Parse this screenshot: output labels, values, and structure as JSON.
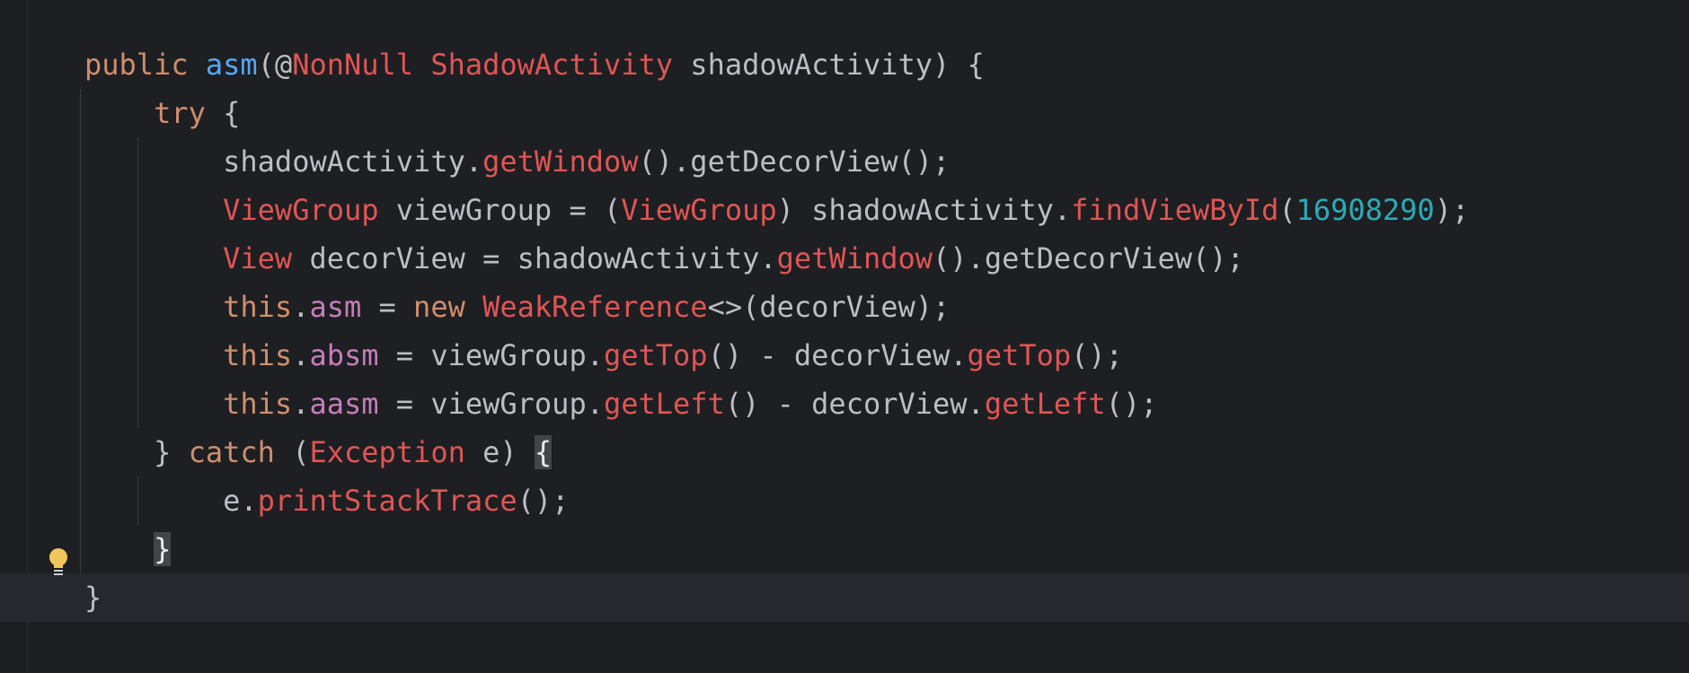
{
  "editor": {
    "lines": [
      [
        {
          "t": "public ",
          "c": "kw"
        },
        {
          "t": "asm",
          "c": "fn-decl"
        },
        {
          "t": "(@",
          "c": "plain"
        },
        {
          "t": "NonNull",
          "c": "type"
        },
        {
          "t": " ",
          "c": "plain"
        },
        {
          "t": "ShadowActivity",
          "c": "type"
        },
        {
          "t": " shadowActivity) {",
          "c": "plain"
        }
      ],
      [
        {
          "t": "    ",
          "c": "plain"
        },
        {
          "t": "try",
          "c": "kw"
        },
        {
          "t": " {",
          "c": "plain"
        }
      ],
      [
        {
          "t": "        shadowActivity.",
          "c": "plain"
        },
        {
          "t": "getWindow",
          "c": "method"
        },
        {
          "t": "().getDecorView();",
          "c": "plain"
        }
      ],
      [
        {
          "t": "        ",
          "c": "plain"
        },
        {
          "t": "ViewGroup",
          "c": "type"
        },
        {
          "t": " viewGroup = (",
          "c": "plain"
        },
        {
          "t": "ViewGroup",
          "c": "type"
        },
        {
          "t": ") shadowActivity.",
          "c": "plain"
        },
        {
          "t": "findViewById",
          "c": "method"
        },
        {
          "t": "(",
          "c": "plain"
        },
        {
          "t": "16908290",
          "c": "num"
        },
        {
          "t": ");",
          "c": "plain"
        }
      ],
      [
        {
          "t": "        ",
          "c": "plain"
        },
        {
          "t": "View",
          "c": "type"
        },
        {
          "t": " decorView = shadowActivity.",
          "c": "plain"
        },
        {
          "t": "getWindow",
          "c": "method"
        },
        {
          "t": "().getDecorView();",
          "c": "plain"
        }
      ],
      [
        {
          "t": "        ",
          "c": "plain"
        },
        {
          "t": "this",
          "c": "kw"
        },
        {
          "t": ".",
          "c": "plain"
        },
        {
          "t": "asm",
          "c": "field"
        },
        {
          "t": " = ",
          "c": "plain"
        },
        {
          "t": "new",
          "c": "kw"
        },
        {
          "t": " ",
          "c": "plain"
        },
        {
          "t": "WeakReference",
          "c": "type"
        },
        {
          "t": "<>(decorView);",
          "c": "plain"
        }
      ],
      [
        {
          "t": "        ",
          "c": "plain"
        },
        {
          "t": "this",
          "c": "kw"
        },
        {
          "t": ".",
          "c": "plain"
        },
        {
          "t": "absm",
          "c": "field"
        },
        {
          "t": " = viewGroup.",
          "c": "plain"
        },
        {
          "t": "getTop",
          "c": "method"
        },
        {
          "t": "() - decorView.",
          "c": "plain"
        },
        {
          "t": "getTop",
          "c": "method"
        },
        {
          "t": "();",
          "c": "plain"
        }
      ],
      [
        {
          "t": "        ",
          "c": "plain"
        },
        {
          "t": "this",
          "c": "kw"
        },
        {
          "t": ".",
          "c": "plain"
        },
        {
          "t": "aasm",
          "c": "field"
        },
        {
          "t": " = viewGroup.",
          "c": "plain"
        },
        {
          "t": "getLeft",
          "c": "method"
        },
        {
          "t": "() - decorView.",
          "c": "plain"
        },
        {
          "t": "getLeft",
          "c": "method"
        },
        {
          "t": "();",
          "c": "plain"
        }
      ],
      [
        {
          "t": "    } ",
          "c": "plain"
        },
        {
          "t": "catch",
          "c": "kw"
        },
        {
          "t": " (",
          "c": "plain"
        },
        {
          "t": "Exception",
          "c": "type"
        },
        {
          "t": " e) ",
          "c": "plain"
        },
        {
          "t": "{",
          "c": "bracket-match"
        }
      ],
      [
        {
          "t": "        e.",
          "c": "plain"
        },
        {
          "t": "printStackTrace",
          "c": "method"
        },
        {
          "t": "();",
          "c": "plain"
        }
      ],
      [
        {
          "t": "    ",
          "c": "plain"
        },
        {
          "t": "}",
          "c": "bracket-match"
        }
      ],
      [
        {
          "t": "}",
          "c": "plain"
        }
      ]
    ],
    "current_line": 11,
    "gutter_icon": "lightbulb-icon",
    "colors": {
      "background": "#1e1f22",
      "keyword": "#cf8e6d",
      "declaration": "#56a8f5",
      "type": "#e05555",
      "number": "#2aacb8",
      "field": "#c77dbb",
      "text": "#bcbec4",
      "bulb": "#f2c55c"
    }
  }
}
